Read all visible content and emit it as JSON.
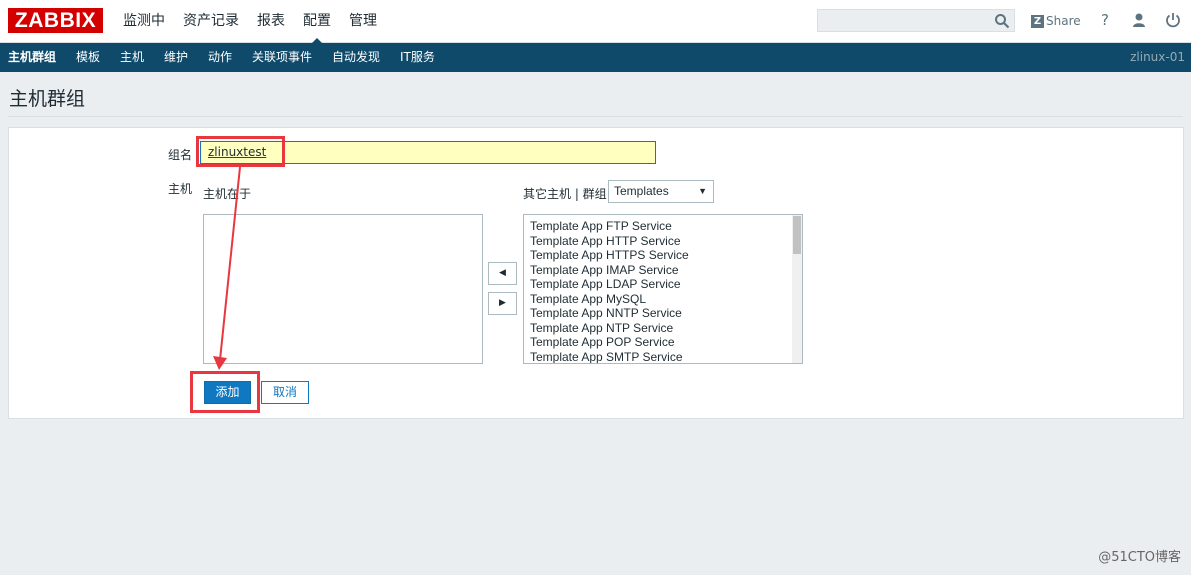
{
  "header": {
    "logo": "ZABBIX",
    "menu": [
      "监测中",
      "资产记录",
      "报表",
      "配置",
      "管理"
    ],
    "active_menu": "配置",
    "search_value": "",
    "share_badge": "Z",
    "share_label": "Share",
    "help_icon": "?"
  },
  "subnav": {
    "items": [
      "主机群组",
      "模板",
      "主机",
      "维护",
      "动作",
      "关联项事件",
      "自动发现",
      "IT服务"
    ],
    "active": "主机群组",
    "hostname": "zlinux-01"
  },
  "page": {
    "title": "主机群组"
  },
  "form": {
    "group_name_label": "组名",
    "group_name_value": "zlinuxtest",
    "hosts_label": "主机",
    "in_group_label": "主机在于",
    "other_hosts_label": "其它主机 | 群组",
    "group_select_value": "Templates",
    "in_group_items": [],
    "other_hosts_items": [
      "Template App FTP Service",
      "Template App HTTP Service",
      "Template App HTTPS Service",
      "Template App IMAP Service",
      "Template App LDAP Service",
      "Template App MySQL",
      "Template App NNTP Service",
      "Template App NTP Service",
      "Template App POP Service",
      "Template App SMTP Service"
    ],
    "move_left": "◀",
    "move_right": "▶",
    "add_button": "添加",
    "cancel_button": "取消"
  },
  "watermark": "@51CTO博客",
  "colors": {
    "brand_red": "#d40000",
    "nav_blue": "#0f4a6b",
    "button_blue": "#0f78c1",
    "highlight_input": "#ffffc0",
    "annotation_red": "#e8373f"
  }
}
